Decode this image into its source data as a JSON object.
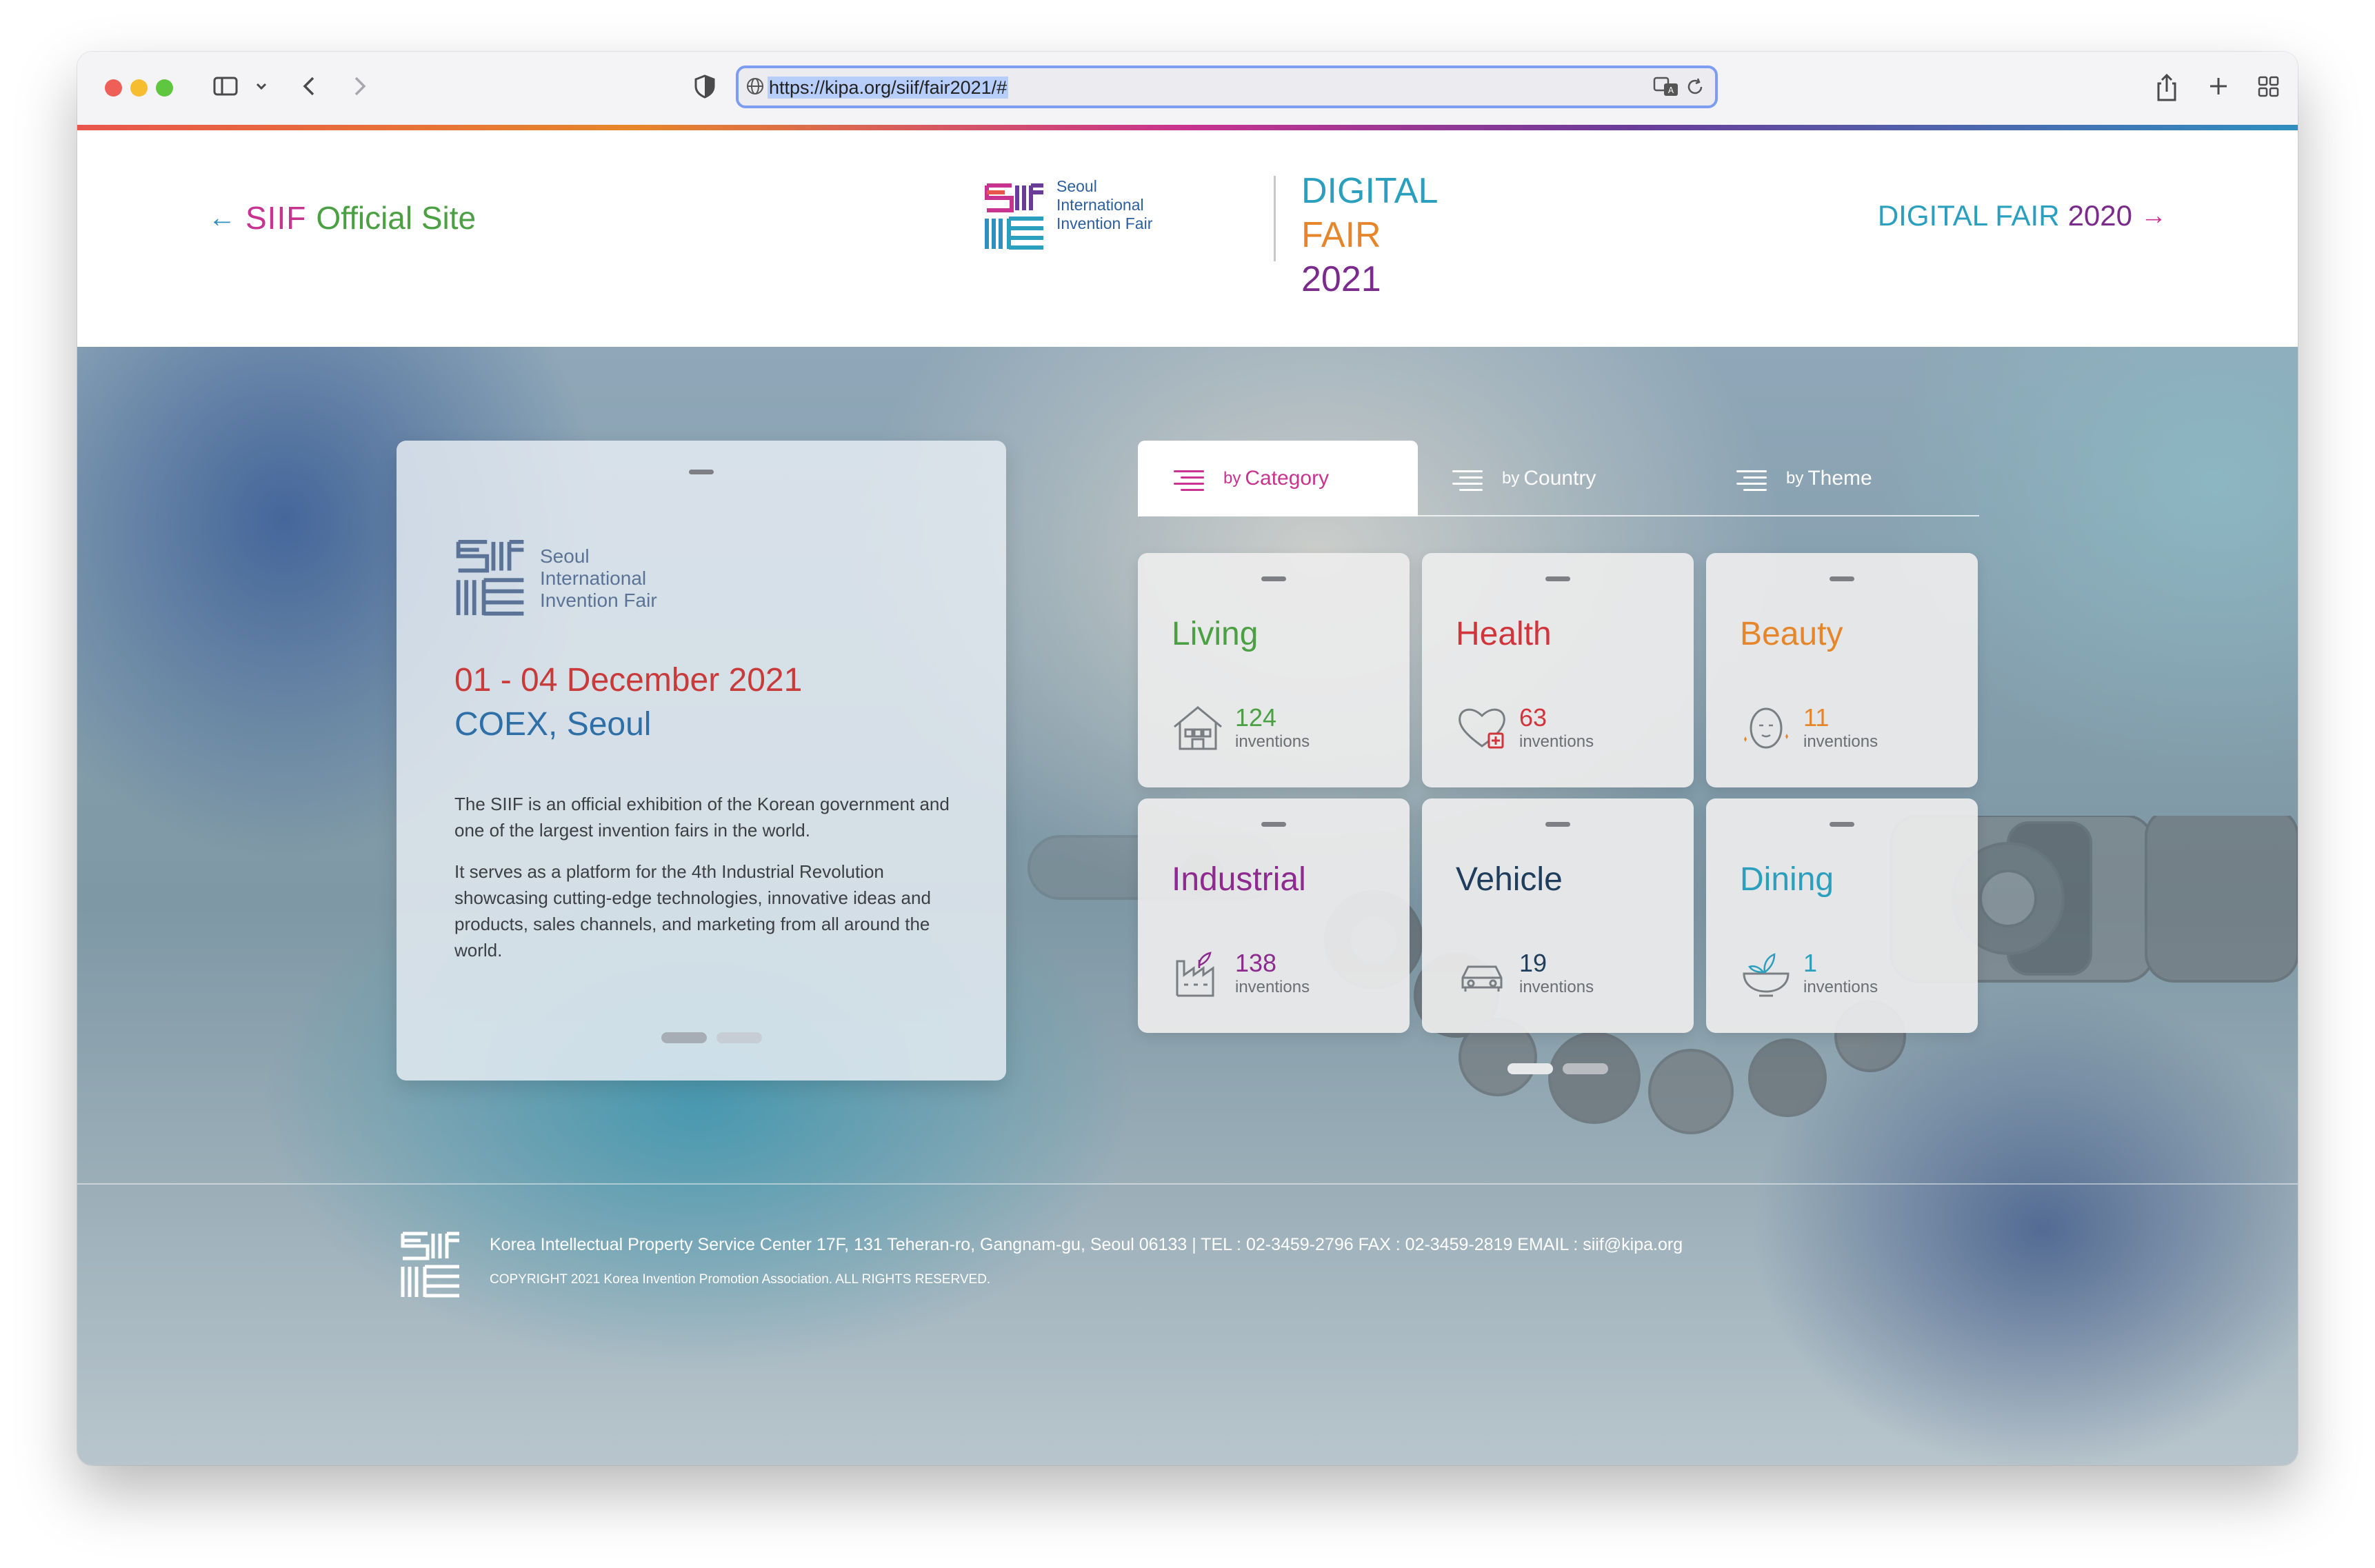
{
  "browser": {
    "url": "https://kipa.org/siif/fair2021/#",
    "traffic_colors": [
      "#ee5f57",
      "#f5bd2f",
      "#5fc63f"
    ]
  },
  "header": {
    "back_arrow": "←",
    "siif_word": "SIIF",
    "official_site": "Official Site",
    "logo_lines": [
      "Seoul",
      "International",
      "Invention Fair"
    ],
    "digital": "DIGITAL",
    "fair": "FAIR",
    "year": "2021",
    "fair2020_prefix": "DIGITAL FAIR",
    "fair2020_year": "2020",
    "forward_arrow": "→"
  },
  "intro": {
    "logo_lines": [
      "Seoul",
      "International",
      "Invention Fair"
    ],
    "dates": "01 - 04 December 2021",
    "venue": "COEX, Seoul",
    "paragraph1": "The SIIF is an official exhibition of the Korean government and one of the largest invention fairs in the world.",
    "paragraph2": "It serves as a platform for the 4th Industrial Revolution showcasing cutting-edge technologies, innovative ideas and products, sales channels, and marketing from all around the world."
  },
  "tabs": [
    {
      "by": "by",
      "name": "Category",
      "active": true
    },
    {
      "by": "by",
      "name": "Country",
      "active": false
    },
    {
      "by": "by",
      "name": "Theme",
      "active": false
    }
  ],
  "categories": [
    {
      "name": "Living",
      "count": "124",
      "label": "inventions",
      "color": "#4aa043",
      "icon": "house-icon"
    },
    {
      "name": "Health",
      "count": "63",
      "label": "inventions",
      "color": "#d2343b",
      "icon": "heart-plus-icon"
    },
    {
      "name": "Beauty",
      "count": "11",
      "label": "inventions",
      "color": "#e6862a",
      "icon": "face-icon"
    },
    {
      "name": "Industrial",
      "count": "138",
      "label": "inventions",
      "color": "#8e2a8f",
      "icon": "factory-icon"
    },
    {
      "name": "Vehicle",
      "count": "19",
      "label": "inventions",
      "color": "#1f3d5c",
      "icon": "car-icon"
    },
    {
      "name": "Dining",
      "count": "1",
      "label": "inventions",
      "color": "#2a9fbe",
      "icon": "bowl-icon"
    }
  ],
  "footer": {
    "address": "Korea Intellectual Property Service Center 17F, 131 Teheran-ro, Gangnam-gu, Seoul 06133  |  TEL : 02-3459-2796 FAX : 02-3459-2819 EMAIL : siif@kipa.org",
    "copyright": "COPYRIGHT 2021 Korea Invention Promotion Association. ALL RIGHTS RESERVED."
  }
}
